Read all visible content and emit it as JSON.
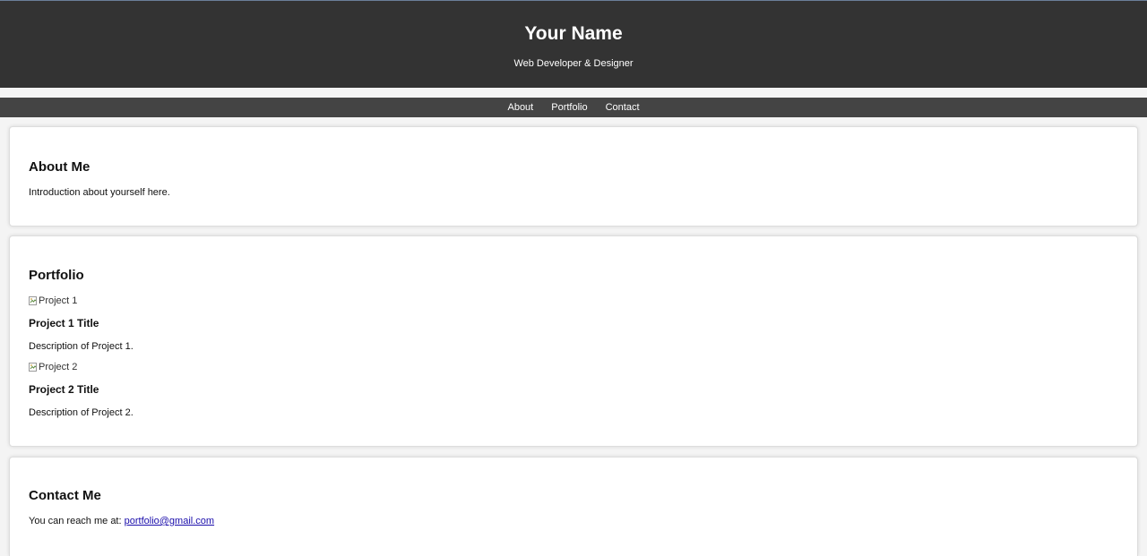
{
  "header": {
    "title": "Your Name",
    "tagline": "Web Developer & Designer"
  },
  "nav": {
    "items": [
      {
        "label": "About"
      },
      {
        "label": "Portfolio"
      },
      {
        "label": "Contact"
      }
    ]
  },
  "about": {
    "heading": "About Me",
    "text": "Introduction about yourself here."
  },
  "portfolio": {
    "heading": "Portfolio",
    "projects": [
      {
        "image_alt": "Project 1",
        "title": "Project 1 Title",
        "description": "Description of Project 1."
      },
      {
        "image_alt": "Project 2",
        "title": "Project 2 Title",
        "description": "Description of Project 2."
      }
    ]
  },
  "contact": {
    "heading": "Contact Me",
    "text": "You can reach me at:",
    "email": "portfolio@gmail.com"
  },
  "colors": {
    "header_bg": "#333333",
    "nav_bg": "#444444",
    "page_bg": "#f4f4f4",
    "link": "#1a0dab"
  }
}
